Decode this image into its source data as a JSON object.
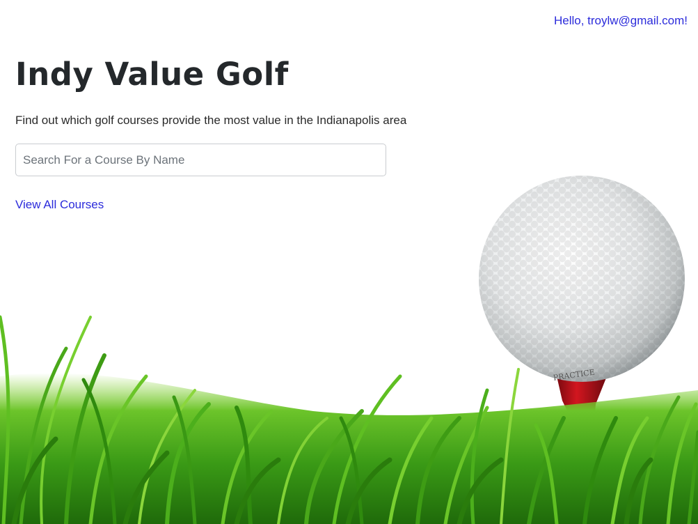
{
  "header": {
    "greeting": "Hello, troylw@gmail.com!"
  },
  "main": {
    "title": "Indy Value Golf",
    "subtitle": "Find out which golf courses provide the most value in the Indianapolis area",
    "search": {
      "placeholder": "Search For a Course By Name",
      "value": ""
    },
    "view_all_label": "View All Courses"
  },
  "colors": {
    "link": "#2b2bdb",
    "title": "#24282b",
    "grass": "#3fa317",
    "tee": "#c1121a"
  },
  "hero_image": {
    "icon": "golf-ball-on-tee-grass-image"
  }
}
